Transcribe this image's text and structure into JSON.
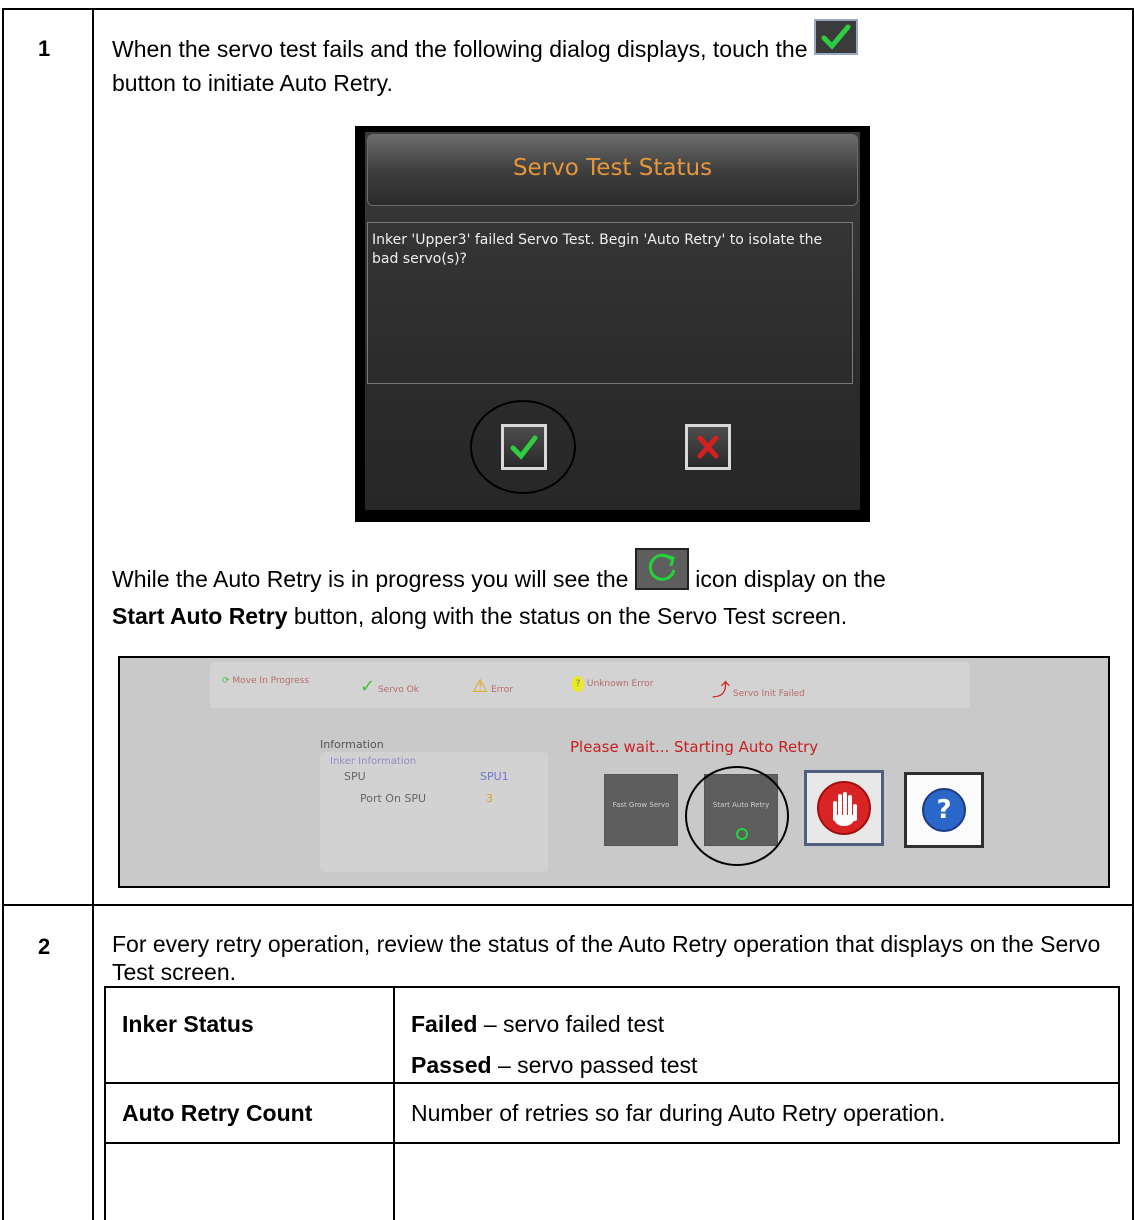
{
  "steps": [
    {
      "number": "1",
      "text_before_icon": "When the servo test fails and the following dialog displays, touch the",
      "text_after_icon": "button to initiate Auto Retry.",
      "dialog": {
        "title": "Servo Test Status",
        "message": "Inker 'Upper3' failed Servo Test. Begin 'Auto Retry' to isolate the bad servo(s)?",
        "confirm_icon": "green-check-icon",
        "cancel_icon": "red-x-icon"
      },
      "progress_text_before_icon": "While the Auto Retry is in progress you will see the",
      "progress_text_after_icon": "icon display on the",
      "progress_bold": "Start Auto Retry",
      "progress_text_end": "button, along with the status on the Servo Test screen.",
      "progress_icon": "green-refresh-icon",
      "servo_panel": {
        "legend": [
          "Move In Progress",
          "Servo Ok",
          "Error",
          "Unknown Error",
          "Servo Init Failed"
        ],
        "info_title": "Information",
        "info_subtitle": "Inker Information",
        "info_rows": [
          {
            "label": "SPU",
            "value": "SPU1"
          },
          {
            "label": "Port On SPU",
            "value": "3"
          }
        ],
        "status_message": "Please wait... Starting Auto Retry",
        "buttons": [
          "Fast Grow Servo",
          "Start Auto Retry"
        ],
        "stop_icon": "stop-hand-icon",
        "help_icon": "help-question-icon"
      }
    },
    {
      "number": "2",
      "text": "For every retry operation, review the status of the Auto Retry operation that displays on the Servo Test screen.",
      "table": [
        {
          "field": "Inker Status",
          "entries": [
            {
              "bold": "Failed",
              "rest": " – servo failed test"
            },
            {
              "bold": "Passed",
              "rest": " – servo passed test"
            }
          ]
        },
        {
          "field": "Auto Retry Count",
          "entries": [
            {
              "bold": "",
              "rest": "Number of retries so far during Auto Retry operation."
            }
          ]
        }
      ]
    }
  ],
  "colors": {
    "dialog_title": "#e6963a",
    "status_message": "#c62020",
    "check_green": "#2ecc40",
    "x_red": "#d42020"
  }
}
